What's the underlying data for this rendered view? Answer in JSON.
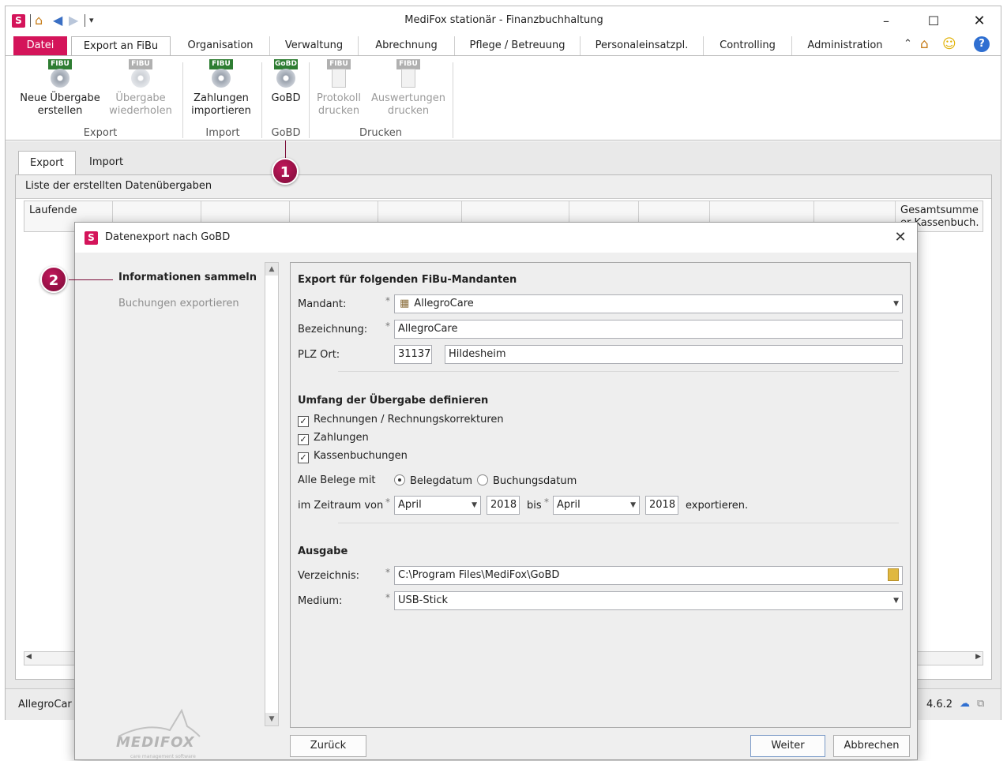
{
  "app": {
    "title": "MediFox stationär - Finanzbuchhaltung",
    "tabs": [
      "Datei",
      "Export an FiBu",
      "Organisation",
      "Verwaltung",
      "Abrechnung",
      "Pflege / Betreuung",
      "Personaleinsatzpl.",
      "Controlling",
      "Administration"
    ]
  },
  "ribbon": {
    "buttons": [
      {
        "badge": "FIBU",
        "line1": "Neue Übergabe",
        "line2": "erstellen"
      },
      {
        "badge": "FIBU",
        "line1": "Übergabe",
        "line2": "wiederholen"
      },
      {
        "badge": "FIBU",
        "line1": "Zahlungen",
        "line2": "importieren"
      },
      {
        "badge": "GoBD",
        "line1": "GoBD",
        "line2": ""
      },
      {
        "badge": "FIBU",
        "line1": "Protokoll",
        "line2": "drucken"
      },
      {
        "badge": "FIBU",
        "line1": "Auswertungen",
        "line2": "drucken"
      }
    ],
    "groups": [
      "Export",
      "Import",
      "GoBD",
      "Drucken"
    ]
  },
  "content": {
    "tabs": [
      "Export",
      "Import"
    ],
    "list_title": "Liste der erstellten Datenübergaben",
    "grid_first_col": "Laufende",
    "grid_last_col_line1": "Gesamtsumme",
    "grid_last_col_line2": "er Kassenbuch.",
    "status_left": "AllegroCar",
    "status_version": "4.6.2"
  },
  "callouts": [
    "1",
    "2"
  ],
  "dialog": {
    "title": "Datenexport nach GoBD",
    "steps": [
      "Informationen sammeln",
      "Buchungen exportieren"
    ],
    "logo_text": "MEDIFOX",
    "logo_sub": "care management software",
    "section_mandant": "Export für folgenden FiBu-Mandanten",
    "mandant_label": "Mandant:",
    "mandant_value": "AllegroCare",
    "bezeichnung_label": "Bezeichnung:",
    "bezeichnung_value": "AllegroCare",
    "plzort_label": "PLZ Ort:",
    "plz_value": "31137",
    "ort_value": "Hildesheim",
    "section_umfang": "Umfang der Übergabe definieren",
    "checkboxes": [
      "Rechnungen / Rechnungskorrekturen",
      "Zahlungen",
      "Kassenbuchungen"
    ],
    "belege_label": "Alle Belege mit",
    "radio_belegdatum": "Belegdatum",
    "radio_buchungsdatum": "Buchungsdatum",
    "zeitraum_label": "im Zeitraum von",
    "from_month": "April",
    "from_year": "2018",
    "bis_label": "bis",
    "to_month": "April",
    "to_year": "2018",
    "exportieren_label": "exportieren.",
    "section_ausgabe": "Ausgabe",
    "verzeichnis_label": "Verzeichnis:",
    "verzeichnis_value": "C:\\Program Files\\MediFox\\GoBD",
    "medium_label": "Medium:",
    "medium_value": "USB-Stick",
    "btn_back": "Zurück",
    "btn_next": "Weiter",
    "btn_cancel": "Abbrechen",
    "required_mark": "*"
  },
  "colors": {
    "brand": "#d4145a",
    "callout": "#9c1245",
    "gobd_badge": "#2e7d32"
  }
}
